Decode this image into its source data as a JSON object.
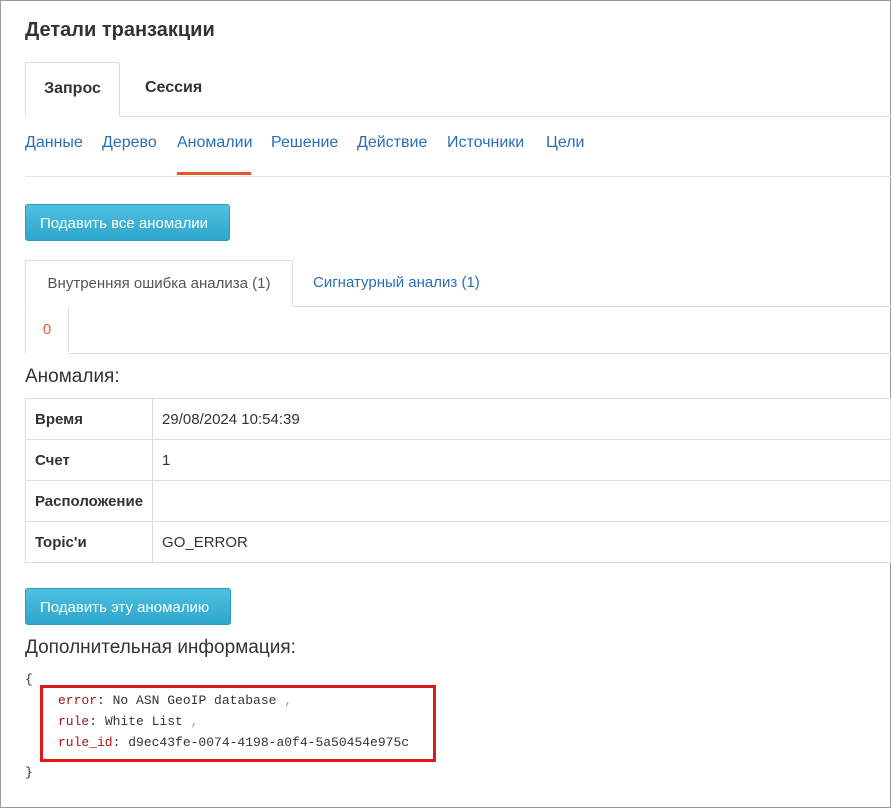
{
  "page": {
    "title": "Детали транзакции"
  },
  "main_tabs": [
    {
      "label": "Запрос",
      "active": true
    },
    {
      "label": "Сессия",
      "active": false
    }
  ],
  "subnav": [
    {
      "label": "Данные"
    },
    {
      "label": "Дерево"
    },
    {
      "label": "Аномалии",
      "active": true
    },
    {
      "label": "Решение"
    },
    {
      "label": "Действие"
    },
    {
      "label": "Источники"
    },
    {
      "label": "Цели"
    }
  ],
  "buttons": {
    "submit_all": "Подавить все аномалии",
    "submit_this": "Подавить эту аномалию"
  },
  "anomaly_tabs": [
    {
      "label": "Внутренняя ошибка анализа (1)",
      "active": true
    },
    {
      "label": "Сигнатурный анализ (1)",
      "active": false
    }
  ],
  "index_tabs": [
    {
      "label": "0",
      "active": true
    }
  ],
  "anomaly": {
    "heading": "Аномалия:",
    "rows": [
      {
        "key": "Время",
        "value": "29/08/2024 10:54:39"
      },
      {
        "key": "Счет",
        "value": "1"
      },
      {
        "key": "Расположение",
        "value": ""
      },
      {
        "key": "Topic'и",
        "value": "GO_ERROR"
      }
    ]
  },
  "extra": {
    "heading": "Дополнительная информация:",
    "open_brace": "{",
    "close_brace": "}",
    "fields": [
      {
        "key": "error",
        "value": "No ASN GeoIP database",
        "comma": ","
      },
      {
        "key": "rule",
        "value": "White List",
        "comma": ","
      },
      {
        "key": "rule_id",
        "value": "d9ec43fe-0074-4198-a0f4-5a50454e975c",
        "comma": ""
      }
    ]
  },
  "colors": {
    "accent": "#2a6eb7",
    "active_underline": "#e4572e",
    "button": "#3bb1d6",
    "highlight_box": "#e0181a"
  }
}
